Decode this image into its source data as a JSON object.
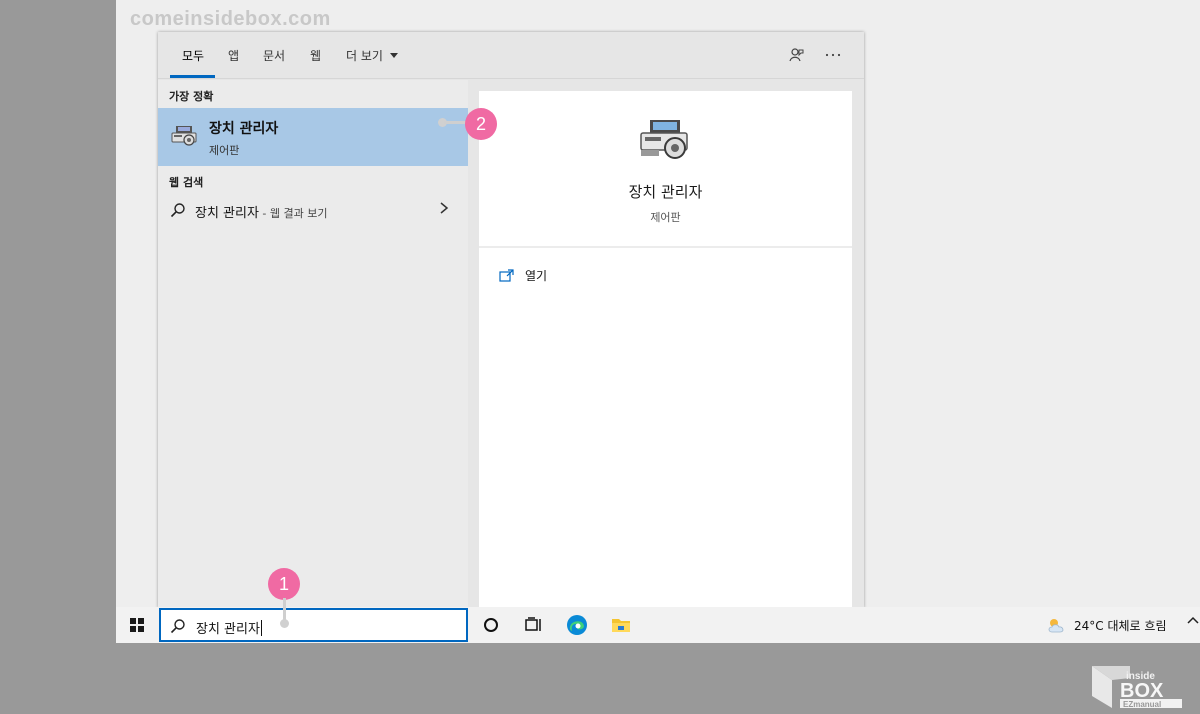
{
  "watermark": "comeinsidebox.com",
  "tabs": [
    {
      "label": "모두"
    },
    {
      "label": "앱"
    },
    {
      "label": "문서"
    },
    {
      "label": "웹"
    }
  ],
  "tab_more": "더 보기",
  "best_match": {
    "section_label": "가장 정확",
    "title": "장치 관리자",
    "subtitle": "제어판"
  },
  "web_search": {
    "section_label": "웹 검색",
    "query": "장치 관리자",
    "suffix": " - 웹 결과 보기"
  },
  "preview": {
    "title": "장치 관리자",
    "subtitle": "제어판",
    "open_label": "열기"
  },
  "taskbar": {
    "search_value": "장치 관리자",
    "weather": "24°C  대체로 흐림"
  },
  "annotations": {
    "step1": "1",
    "step2": "2"
  },
  "logo": {
    "text_top": "inside",
    "text_main": "BOX",
    "text_bottom": "EZmanual"
  },
  "colors": {
    "accent": "#0067c0",
    "selection": "#a8c8e6",
    "badge": "#f06aa3"
  }
}
